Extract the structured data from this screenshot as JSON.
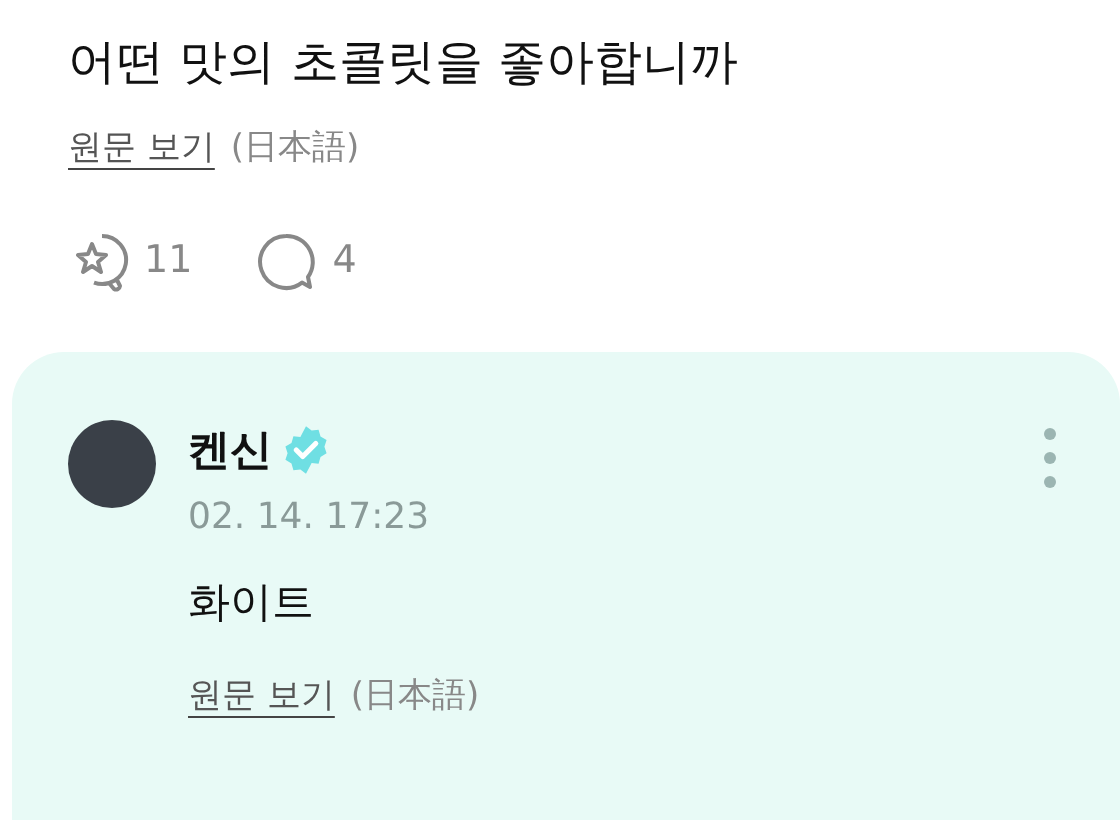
{
  "post": {
    "text": "어떤 맛의 초콜릿을 좋아합니까",
    "translation": {
      "link": "원문 보기",
      "language": "(日本語)"
    },
    "reactions": {
      "likes": "11",
      "comments": "4"
    }
  },
  "comment": {
    "author": "켄신",
    "verified": true,
    "time": "02. 14. 17:23",
    "text": "화이트",
    "translation": {
      "link": "원문 보기",
      "language": "(日本語)"
    }
  }
}
